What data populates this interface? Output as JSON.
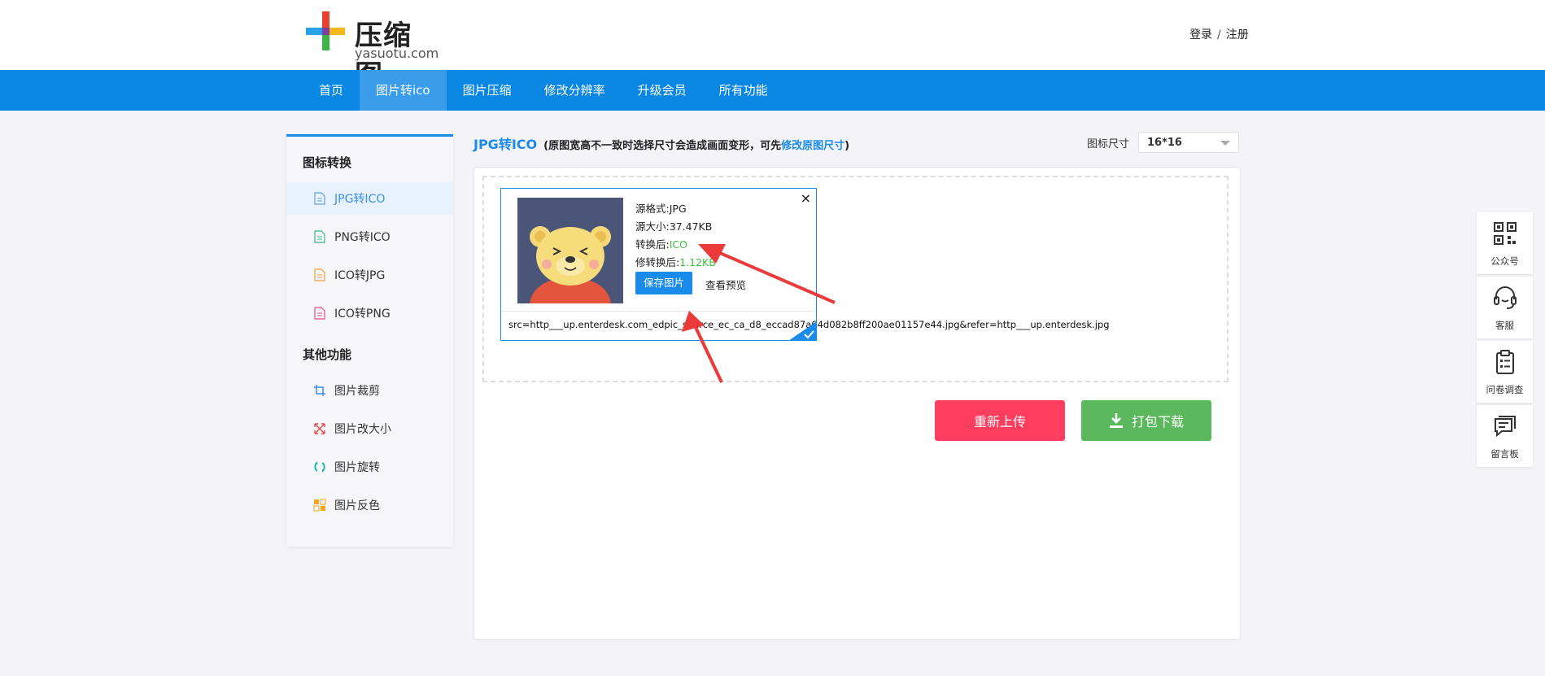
{
  "header": {
    "logo_name": "压缩图",
    "logo_domain": "yasuotu.com",
    "login": "登录",
    "separator": "/",
    "register": "注册"
  },
  "nav": {
    "items": [
      {
        "label": "首页",
        "active": false
      },
      {
        "label": "图片转ico",
        "active": true
      },
      {
        "label": "图片压缩",
        "active": false
      },
      {
        "label": "修改分辨率",
        "active": false
      },
      {
        "label": "升级会员",
        "active": false
      },
      {
        "label": "所有功能",
        "active": false
      }
    ]
  },
  "sidebar": {
    "section1": "图标转换",
    "section1_items": [
      {
        "label": "JPG转ICO",
        "icon": "file-doc-icon",
        "active": true
      },
      {
        "label": "PNG转ICO",
        "icon": "file-doc-icon",
        "active": false
      },
      {
        "label": "ICO转JPG",
        "icon": "file-doc-icon",
        "active": false
      },
      {
        "label": "ICO转PNG",
        "icon": "file-doc-icon",
        "active": false
      }
    ],
    "section2": "其他功能",
    "section2_items": [
      {
        "label": "图片裁剪",
        "icon": "crop-icon"
      },
      {
        "label": "图片改大小",
        "icon": "resize-icon"
      },
      {
        "label": "图片旋转",
        "icon": "rotate-icon"
      },
      {
        "label": "图片反色",
        "icon": "invert-icon"
      }
    ]
  },
  "main": {
    "title": "JPG转ICO",
    "note_prefix": "(原图宽高不一致时选择尺寸会造成画面变形，可先",
    "note_link": "修改原图尺寸",
    "note_suffix": ")",
    "size_label": "图标尺寸",
    "size_value": "16*16"
  },
  "card": {
    "close": "×",
    "source_format_label": "源格式:",
    "source_format": "JPG",
    "source_size_label": "源大小:",
    "source_size": "37.47KB",
    "converted_label": "转换后:",
    "converted_format": "ICO",
    "converted_size_label": "修转换后:",
    "converted_size": "1.12KB",
    "save_button": "保存图片",
    "preview_link": "查看预览",
    "filename": "src=http___up.enterdesk.com_edpic_source_ec_ca_d8_eccad87a64d082b8ff200ae01157e44.jpg&refer=http___up.enterdesk.jpg"
  },
  "actions": {
    "reupload": "重新上传",
    "download": "打包下载"
  },
  "float_bar": {
    "items": [
      {
        "label": "公众号",
        "icon": "qrcode-icon"
      },
      {
        "label": "客服",
        "icon": "headset-icon"
      },
      {
        "label": "问卷调查",
        "icon": "clipboard-icon"
      },
      {
        "label": "留言板",
        "icon": "message-board-icon"
      }
    ]
  },
  "colors": {
    "nav": "#0a86e3",
    "accent": "#1a8bea",
    "reupload": "#ff3d5f",
    "download": "#5cb85c",
    "success": "#3cbe3c"
  }
}
